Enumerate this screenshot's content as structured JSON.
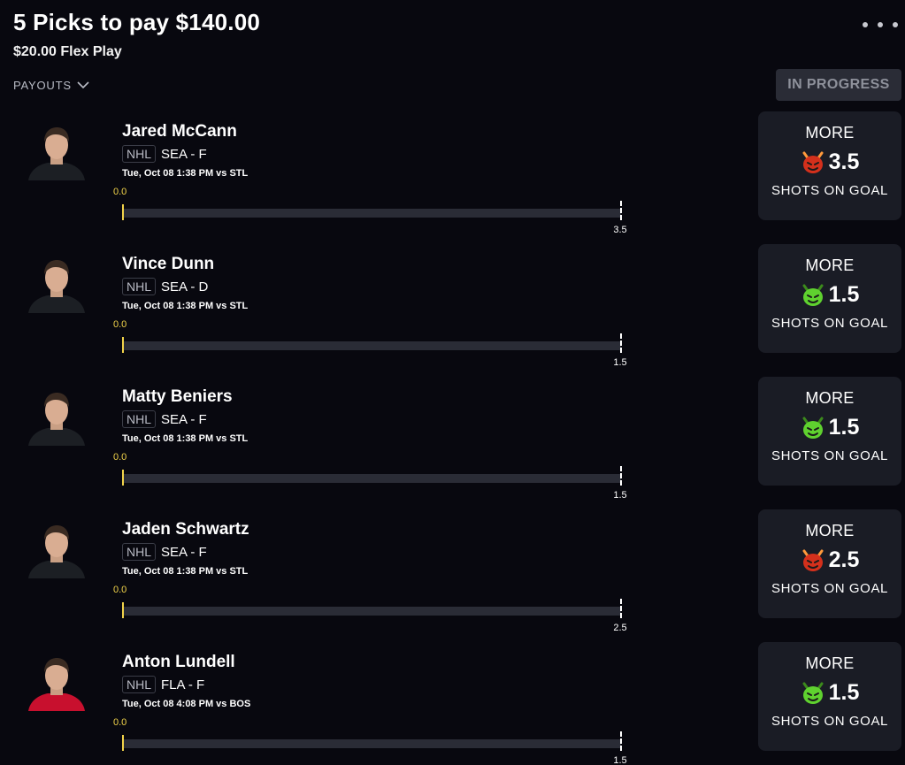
{
  "header": {
    "title": "5 Picks to pay $140.00",
    "subtitle": "$20.00 Flex Play",
    "payouts_label": "PAYOUTS",
    "status_label": "IN PROGRESS"
  },
  "picks": [
    {
      "name": "Jared McCann",
      "league": "NHL",
      "team_position": "SEA - F",
      "game_time": "Tue, Oct 08 1:38 PM  vs STL",
      "current_value": "0.0",
      "progress": 0,
      "line": "3.5",
      "direction": "MORE",
      "stat": "SHOTS ON GOAL",
      "demon_type": "red-demon-icon",
      "jersey_color": "#1c1f24"
    },
    {
      "name": "Vince Dunn",
      "league": "NHL",
      "team_position": "SEA - D",
      "game_time": "Tue, Oct 08 1:38 PM  vs STL",
      "current_value": "0.0",
      "progress": 0,
      "line": "1.5",
      "direction": "MORE",
      "stat": "SHOTS ON GOAL",
      "demon_type": "green-goblin-icon",
      "jersey_color": "#1c1f24"
    },
    {
      "name": "Matty Beniers",
      "league": "NHL",
      "team_position": "SEA - F",
      "game_time": "Tue, Oct 08 1:38 PM  vs STL",
      "current_value": "0.0",
      "progress": 0,
      "line": "1.5",
      "direction": "MORE",
      "stat": "SHOTS ON GOAL",
      "demon_type": "green-goblin-icon",
      "jersey_color": "#1c1f24"
    },
    {
      "name": "Jaden Schwartz",
      "league": "NHL",
      "team_position": "SEA - F",
      "game_time": "Tue, Oct 08 1:38 PM  vs STL",
      "current_value": "0.0",
      "progress": 0,
      "line": "2.5",
      "direction": "MORE",
      "stat": "SHOTS ON GOAL",
      "demon_type": "red-demon-icon",
      "jersey_color": "#1c1f24"
    },
    {
      "name": "Anton Lundell",
      "league": "NHL",
      "team_position": "FLA - F",
      "game_time": "Tue, Oct 08 4:08 PM  vs BOS",
      "current_value": "0.0",
      "progress": 0,
      "line": "1.5",
      "direction": "MORE",
      "stat": "SHOTS ON GOAL",
      "demon_type": "green-goblin-icon",
      "jersey_color": "#c8102e"
    }
  ],
  "colors": {
    "background": "#08080f",
    "card": "#1a1c25",
    "track": "#2a2c36",
    "accent_yellow": "#f1d34a",
    "demon_red": "#d4301c",
    "goblin_green": "#5fd12f"
  }
}
